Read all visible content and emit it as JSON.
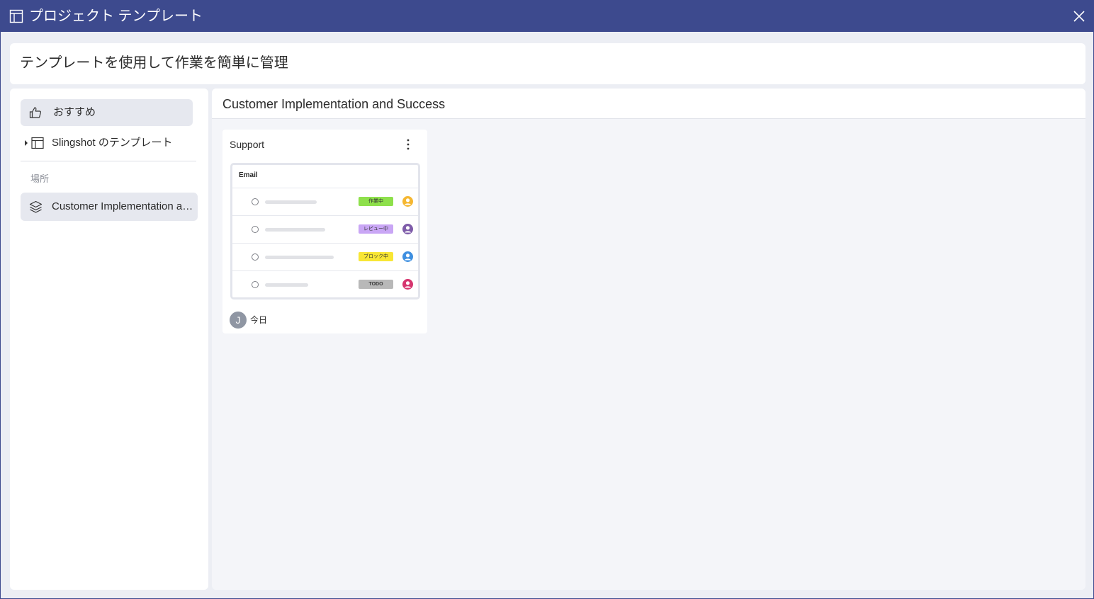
{
  "window": {
    "title": "プロジェクト テンプレート",
    "title_icon": "template-icon",
    "close_icon": "close-icon",
    "accent": "#3d4a8e"
  },
  "headline": "テンプレートを使用して作業を簡単に管理",
  "sidebar": {
    "items": [
      {
        "label": "おすすめ",
        "icon": "thumbs-up-icon",
        "active": true
      },
      {
        "label": "Slingshot のテンプレート",
        "icon": "template-icon",
        "expandable": true
      }
    ],
    "section_label": "場所",
    "locations": [
      {
        "label": "Customer Implementation and Success",
        "icon": "layers-icon",
        "active": true
      }
    ]
  },
  "main": {
    "title": "Customer Implementation and Success",
    "cards": [
      {
        "title": "Support",
        "preview": {
          "header": "Email",
          "rows": [
            {
              "tag": "作業中",
              "tag_color": "#8ee04b",
              "avatar_color": "#f5b731"
            },
            {
              "tag": "レビュー中",
              "tag_color": "#c9a6f5",
              "avatar_color": "#7e5ca9"
            },
            {
              "tag": "ブロック中",
              "tag_color": "#f8e635",
              "avatar_color": "#3e8fe0"
            },
            {
              "tag": "TODO",
              "tag_color": "#b8b8b8",
              "avatar_color": "#d6356f"
            }
          ]
        },
        "owner_initial": "J",
        "date": "今日"
      }
    ]
  }
}
